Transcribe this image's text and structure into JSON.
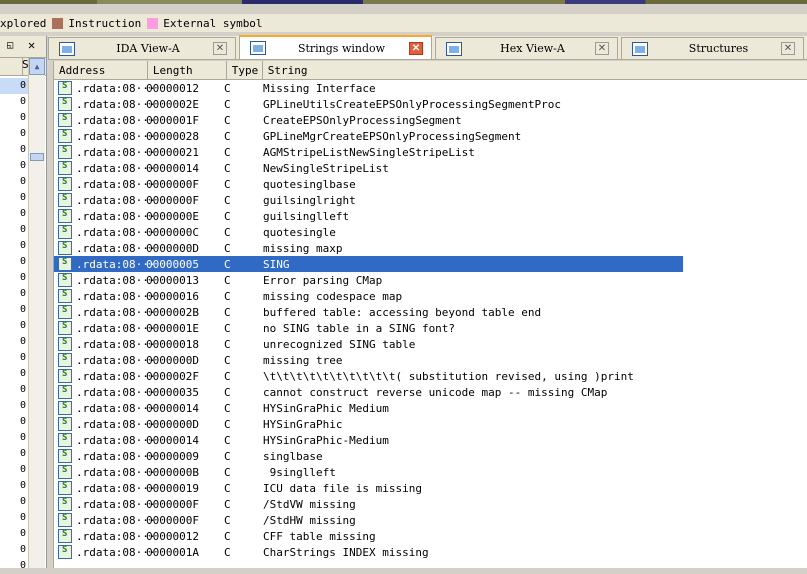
{
  "legend": [
    {
      "label": "xplored",
      "color": null
    },
    {
      "label": "Instruction",
      "color": "#a9705a"
    },
    {
      "label": "External symbol",
      "color": "#ff9be0"
    }
  ],
  "left_pane": {
    "column_header": "S",
    "cells": [
      "0:",
      "0:",
      "0:",
      "0:",
      "0:",
      "0:",
      "0:",
      "0:",
      "0:",
      "0:",
      "0:",
      "0:",
      "0:",
      "0:",
      "0:",
      "0:",
      "0:",
      "0:",
      "0:",
      "0:",
      "0:",
      "0:",
      "0:",
      "0:",
      "0:",
      "0:",
      "0:",
      "0:",
      "0:",
      "0:",
      "0:"
    ]
  },
  "tabs": [
    {
      "label": "IDA View-A",
      "active": false
    },
    {
      "label": "Strings window",
      "active": true
    },
    {
      "label": "Hex View-A",
      "active": false
    },
    {
      "label": "Structures",
      "active": false
    }
  ],
  "columns": [
    "Address",
    "Length",
    "Type",
    "String"
  ],
  "rows": [
    {
      "address": ".rdata:08···",
      "length": "00000012",
      "type": "C",
      "string": "Missing Interface"
    },
    {
      "address": ".rdata:08···",
      "length": "0000002E",
      "type": "C",
      "string": "GPLineUtilsCreateEPSOnlyProcessingSegmentProc"
    },
    {
      "address": ".rdata:08···",
      "length": "0000001F",
      "type": "C",
      "string": "CreateEPSOnlyProcessingSegment"
    },
    {
      "address": ".rdata:08···",
      "length": "00000028",
      "type": "C",
      "string": "GPLineMgrCreateEPSOnlyProcessingSegment"
    },
    {
      "address": ".rdata:08···",
      "length": "00000021",
      "type": "C",
      "string": "AGMStripeListNewSingleStripeList"
    },
    {
      "address": ".rdata:08···",
      "length": "00000014",
      "type": "C",
      "string": "NewSingleStripeList"
    },
    {
      "address": ".rdata:08···",
      "length": "0000000F",
      "type": "C",
      "string": "quotesinglbase"
    },
    {
      "address": ".rdata:08···",
      "length": "0000000F",
      "type": "C",
      "string": "guilsinglright"
    },
    {
      "address": ".rdata:08···",
      "length": "0000000E",
      "type": "C",
      "string": "guilsinglleft"
    },
    {
      "address": ".rdata:08···",
      "length": "0000000C",
      "type": "C",
      "string": "quotesingle"
    },
    {
      "address": ".rdata:08···",
      "length": "0000000D",
      "type": "C",
      "string": "missing maxp"
    },
    {
      "address": ".rdata:08···",
      "length": "00000005",
      "type": "C",
      "string": "SING",
      "selected": true
    },
    {
      "address": ".rdata:08···",
      "length": "00000013",
      "type": "C",
      "string": "Error parsing CMap"
    },
    {
      "address": ".rdata:08···",
      "length": "00000016",
      "type": "C",
      "string": "missing codespace map"
    },
    {
      "address": ".rdata:08···",
      "length": "0000002B",
      "type": "C",
      "string": "buffered table: accessing beyond table end"
    },
    {
      "address": ".rdata:08···",
      "length": "0000001E",
      "type": "C",
      "string": "no SING table in a SING font?"
    },
    {
      "address": ".rdata:08···",
      "length": "00000018",
      "type": "C",
      "string": "unrecognized SING table"
    },
    {
      "address": ".rdata:08···",
      "length": "0000000D",
      "type": "C",
      "string": "missing tree"
    },
    {
      "address": ".rdata:08···",
      "length": "0000002F",
      "type": "C",
      "string": "\\t\\t\\t\\t\\t\\t\\t\\t\\t\\t( substitution revised, using )print"
    },
    {
      "address": ".rdata:08···",
      "length": "00000035",
      "type": "C",
      "string": "cannot construct reverse unicode map -- missing CMap"
    },
    {
      "address": ".rdata:08···",
      "length": "00000014",
      "type": "C",
      "string": "HYSinGraPhic Medium"
    },
    {
      "address": ".rdata:08···",
      "length": "0000000D",
      "type": "C",
      "string": "HYSinGraPhic"
    },
    {
      "address": ".rdata:08···",
      "length": "00000014",
      "type": "C",
      "string": "HYSinGraPhic-Medium"
    },
    {
      "address": ".rdata:08···",
      "length": "00000009",
      "type": "C",
      "string": "singlbase"
    },
    {
      "address": ".rdata:08···",
      "length": "0000000B",
      "type": "C",
      "string": " 9singlleft"
    },
    {
      "address": ".rdata:08···",
      "length": "00000019",
      "type": "C",
      "string": "ICU data file is missing"
    },
    {
      "address": ".rdata:08···",
      "length": "0000000F",
      "type": "C",
      "string": "/StdVW missing"
    },
    {
      "address": ".rdata:08···",
      "length": "0000000F",
      "type": "C",
      "string": "/StdHW missing"
    },
    {
      "address": ".rdata:08···",
      "length": "00000012",
      "type": "C",
      "string": "CFF table missing"
    },
    {
      "address": ".rdata:08···",
      "length": "0000001A",
      "type": "C",
      "string": "CharStrings INDEX missing"
    }
  ]
}
